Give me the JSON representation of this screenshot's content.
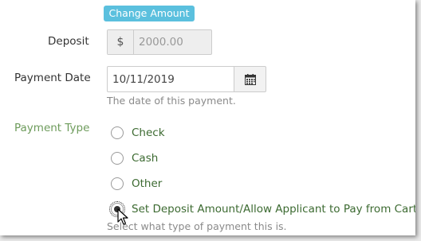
{
  "actions": {
    "change_amount_label": "Change Amount"
  },
  "deposit": {
    "label": "Deposit",
    "currency_symbol": "$",
    "placeholder": "2000.00"
  },
  "payment_date": {
    "label": "Payment Date",
    "value": "10/11/2019",
    "help": "The date of this payment."
  },
  "payment_type": {
    "label": "Payment Type",
    "options": [
      {
        "label": "Check",
        "selected": false
      },
      {
        "label": "Cash",
        "selected": false
      },
      {
        "label": "Other",
        "selected": false
      },
      {
        "label": "Set Deposit Amount/Allow Applicant to Pay from Cart",
        "selected": true
      }
    ],
    "help": "Select what type of payment this is."
  },
  "colors": {
    "button": "#5bc0de",
    "payment_type_label": "#6d9b5b",
    "option_text": "#3c6a31"
  }
}
